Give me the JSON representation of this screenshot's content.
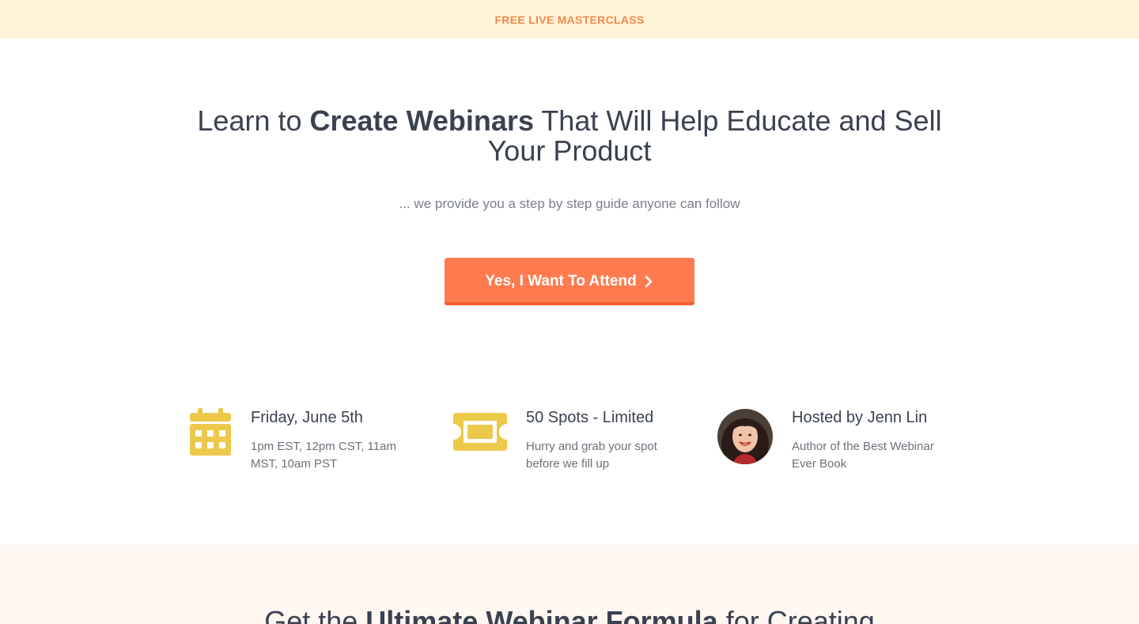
{
  "topbar": {
    "label": "FREE LIVE MASTERCLASS"
  },
  "hero": {
    "headline_pre": "Learn to ",
    "headline_bold": "Create Webinars",
    "headline_post": " That Will Help Educate and Sell Your Product",
    "subhead": "... we provide you a step by step guide anyone can follow",
    "cta_label": "Yes, I Want To Attend"
  },
  "features": [
    {
      "icon": "calendar-icon",
      "title": "Friday, June 5th",
      "desc": "1pm EST, 12pm CST, 11am MST, 10am PST"
    },
    {
      "icon": "ticket-icon",
      "title": "50 Spots - Limited",
      "desc": "Hurry and grab your spot before we fill up"
    },
    {
      "icon": "host-avatar",
      "title": "Hosted by Jenn Lin",
      "desc": "Author of the Best Webinar Ever Book"
    }
  ],
  "bottom": {
    "heading_pre": "Get the ",
    "heading_bold": "Ultimate Webinar Formula",
    "heading_post": " for Creating"
  },
  "colors": {
    "topbar_bg": "#fff3d8",
    "topbar_text": "#ef8a4f",
    "cta_bg": "#ff7b4f",
    "cta_border": "#f05d2a",
    "icon_yellow": "#ecc94b",
    "bottom_bg": "#fff7f1"
  }
}
